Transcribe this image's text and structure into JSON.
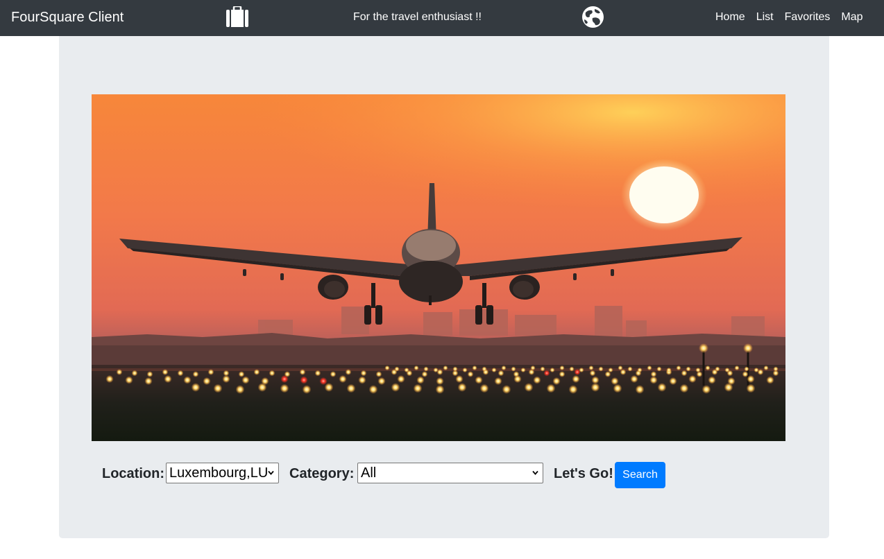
{
  "navbar": {
    "brand": "FourSquare Client",
    "tagline": "For the travel enthusiast !!",
    "links": [
      "Home",
      "List",
      "Favorites",
      "Map"
    ],
    "icons": {
      "left": "suitcase-icon",
      "right": "globe-icon"
    },
    "background": "#343a40"
  },
  "search_form": {
    "location_label": "Location:",
    "location_value": "Luxembourg,LU",
    "category_label": "Category:",
    "category_value": "All",
    "go_label": "Let's Go!",
    "search_button": "Search"
  },
  "colors": {
    "primary": "#007bff",
    "jumbotron": "#e9ecef"
  }
}
